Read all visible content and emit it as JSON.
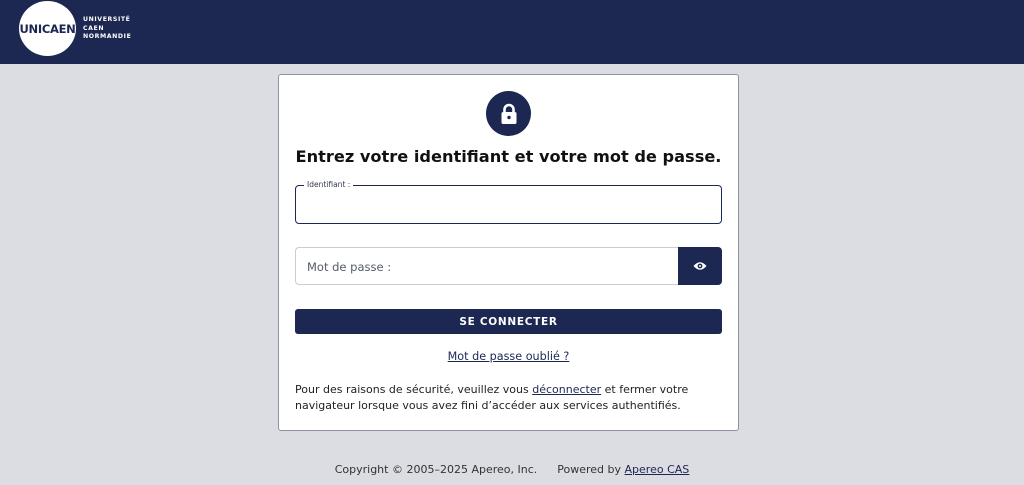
{
  "header": {
    "logo_mark": "UNICAEN",
    "logo_lines": [
      "UNIVERSITÉ",
      "CAEN",
      "NORMANDIE"
    ],
    "background": "#1c2752"
  },
  "login": {
    "lock_icon": "lock-icon",
    "heading": "Entrez votre identifiant et votre mot de passe.",
    "username_label": "Identifiant :",
    "username_value": "",
    "password_placeholder": "Mot de passe :",
    "password_value": "",
    "show_password_icon": "eye-icon",
    "submit_label": "SE CONNECTER",
    "forgot_link": "Mot de passe oublié ?",
    "notice_before": "Pour des raisons de sécurité, veuillez vous ",
    "notice_link": "déconnecter",
    "notice_after": " et fermer votre navigateur lorsque vous avez fini d’accéder aux services authentifiés."
  },
  "footer": {
    "copyright": "Copyright © 2005–2025 Apereo, Inc.",
    "powered_prefix": "Powered by ",
    "powered_link": "Apereo CAS"
  },
  "colors": {
    "accent": "#1c2752",
    "page_background": "#dcdde2"
  }
}
